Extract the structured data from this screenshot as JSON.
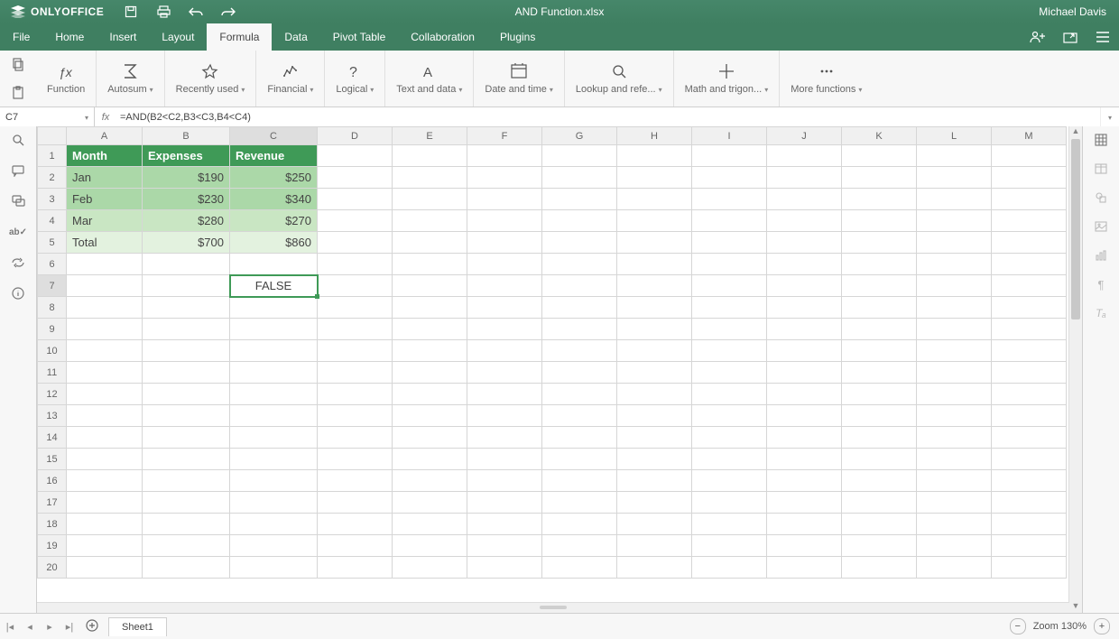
{
  "app": {
    "name": "ONLYOFFICE",
    "file_title": "AND Function.xlsx",
    "user": "Michael Davis"
  },
  "menu": {
    "items": [
      "File",
      "Home",
      "Insert",
      "Layout",
      "Formula",
      "Data",
      "Pivot Table",
      "Collaboration",
      "Plugins"
    ],
    "active": "Formula"
  },
  "ribbon": {
    "items": [
      {
        "id": "function",
        "label": "Function",
        "dropdown": false
      },
      {
        "id": "autosum",
        "label": "Autosum",
        "dropdown": true
      },
      {
        "id": "recent",
        "label": "Recently used",
        "dropdown": true
      },
      {
        "id": "financial",
        "label": "Financial",
        "dropdown": true
      },
      {
        "id": "logical",
        "label": "Logical",
        "dropdown": true
      },
      {
        "id": "text",
        "label": "Text and data",
        "dropdown": true
      },
      {
        "id": "datetime",
        "label": "Date and time",
        "dropdown": true
      },
      {
        "id": "lookup",
        "label": "Lookup and refe...",
        "dropdown": true
      },
      {
        "id": "math",
        "label": "Math and trigon...",
        "dropdown": true
      },
      {
        "id": "more",
        "label": "More functions",
        "dropdown": true
      }
    ]
  },
  "formula_bar": {
    "cell_ref": "C7",
    "formula": "=AND(B2<C2,B3<C3,B4<C4)"
  },
  "grid": {
    "columns": [
      "A",
      "B",
      "C",
      "D",
      "E",
      "F",
      "G",
      "H",
      "I",
      "J",
      "K",
      "L",
      "M"
    ],
    "row_count": 20,
    "selected_col": "C",
    "selected_row": 7,
    "headers": {
      "A": "Month",
      "B": "Expenses",
      "C": "Revenue"
    },
    "data": [
      {
        "A": "Jan",
        "B": "$190",
        "C": "$250"
      },
      {
        "A": "Feb",
        "B": "$230",
        "C": "$340"
      },
      {
        "A": "Mar",
        "B": "$280",
        "C": "$270"
      },
      {
        "A": "Total",
        "B": "$700",
        "C": "$860"
      }
    ],
    "result_cell": {
      "row": 7,
      "col": "C",
      "value": "FALSE"
    }
  },
  "status": {
    "sheet_tab": "Sheet1",
    "zoom_label": "Zoom 130%"
  }
}
